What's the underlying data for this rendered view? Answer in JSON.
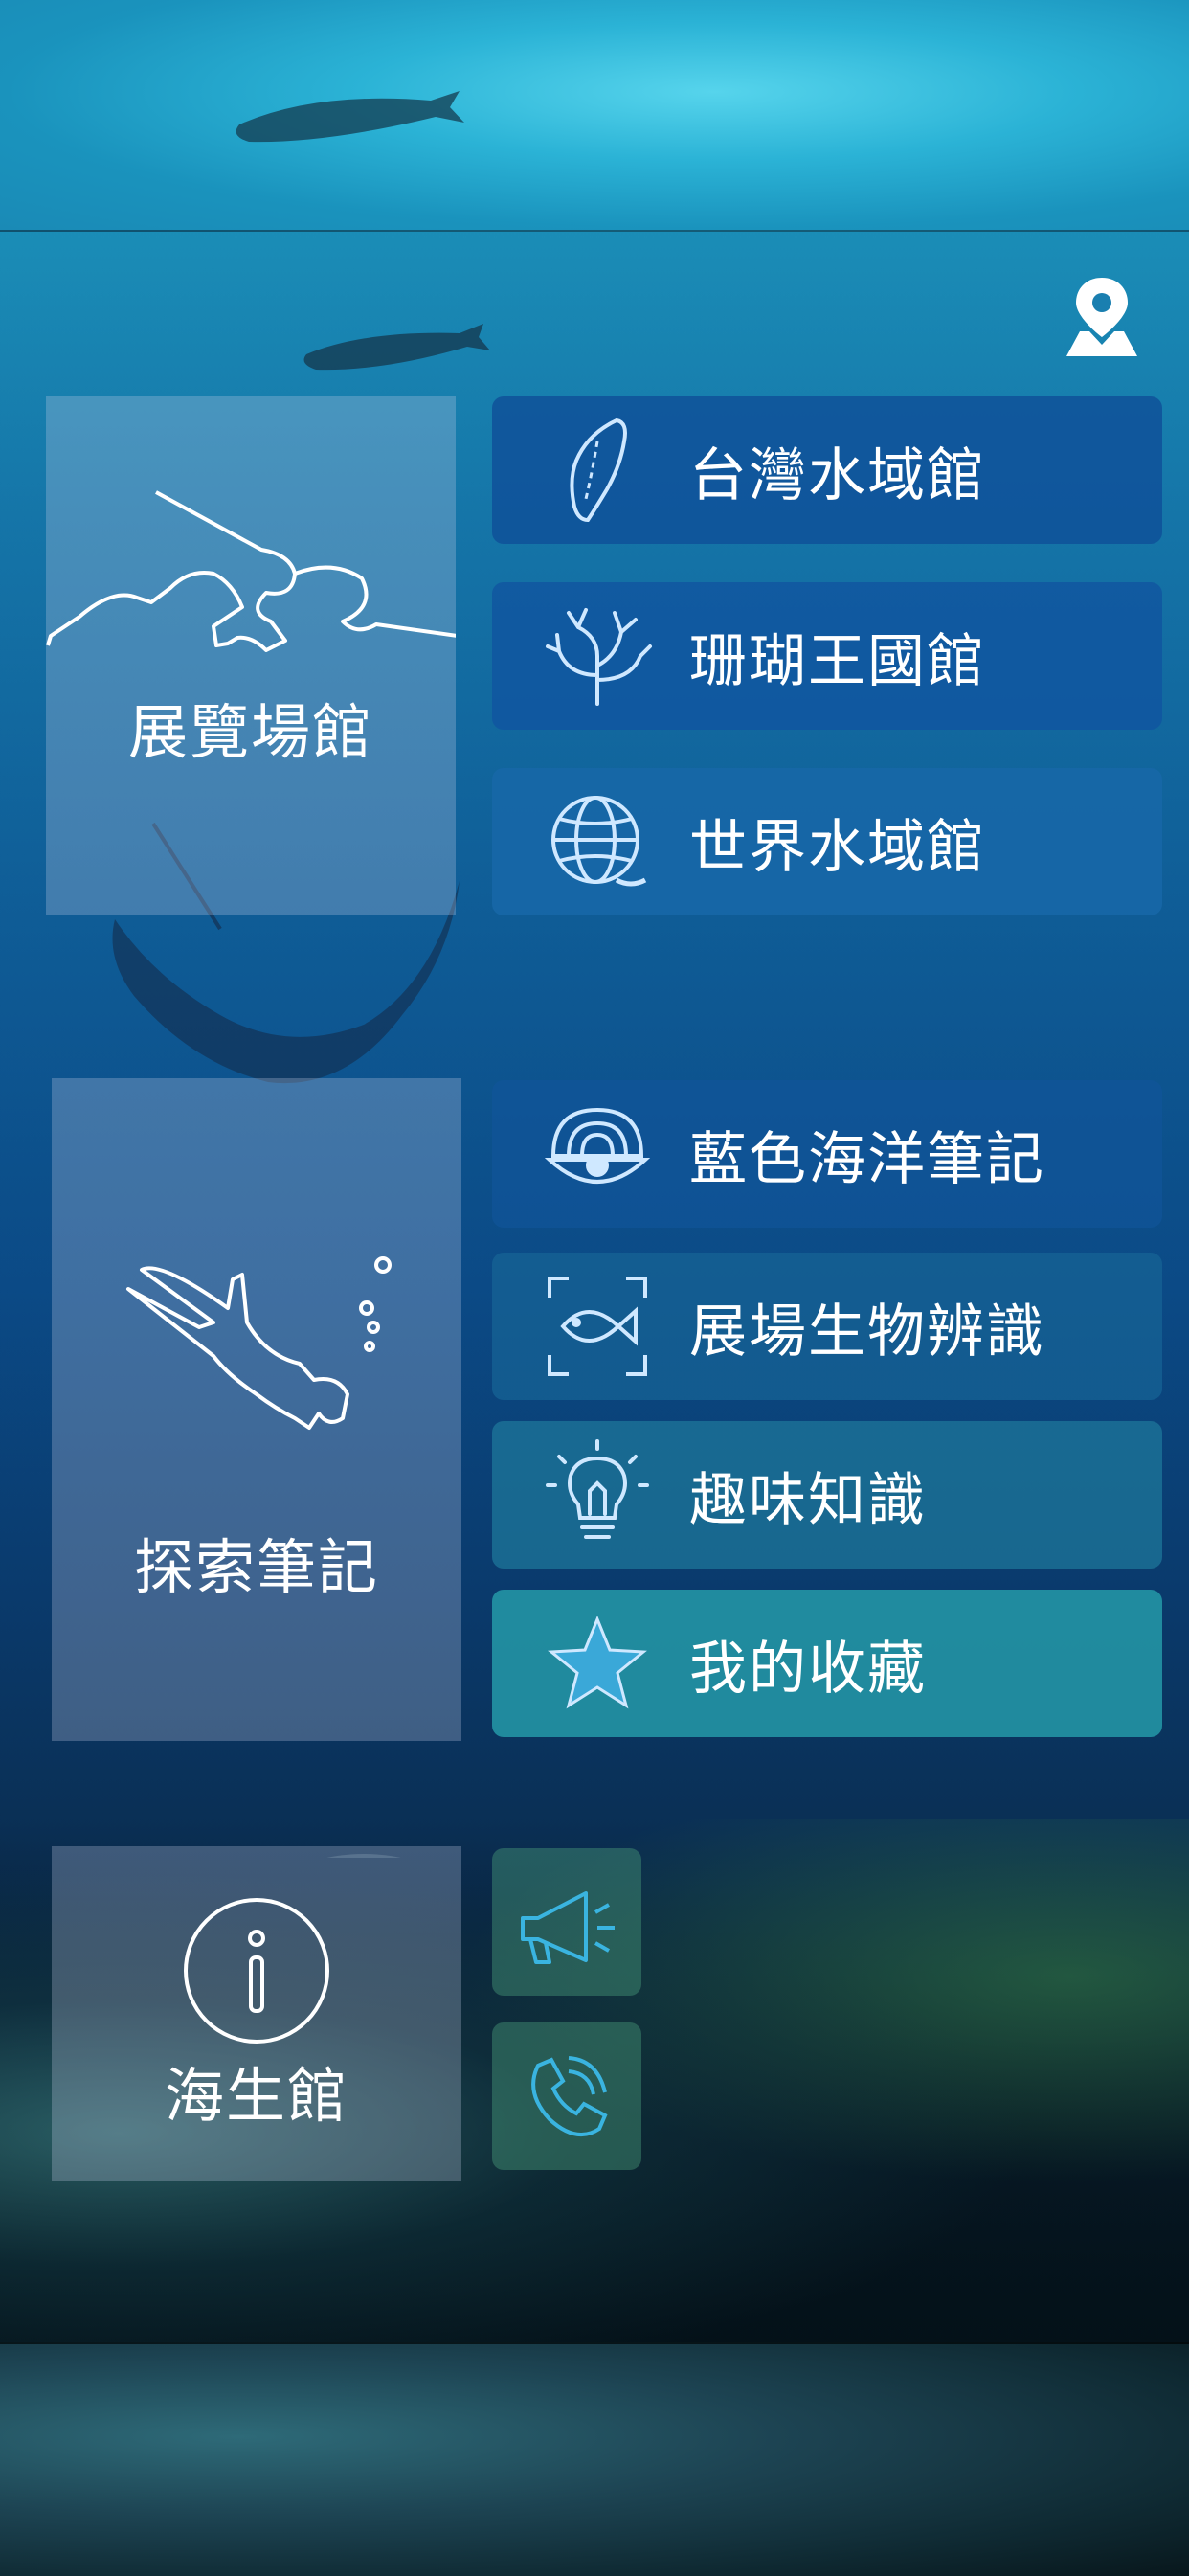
{
  "colors": {
    "button_dark": "#0f4f99",
    "button_mid": "#1767a8",
    "button_teal": "#2396a6",
    "panel": "rgba(200,210,235,0.28)"
  },
  "header": {
    "map_icon": "map-pin-icon"
  },
  "sections": {
    "exhibit": {
      "label": "展覽場館",
      "icon": "narwhal-outline-icon",
      "items": [
        {
          "label": "台灣水域館",
          "icon": "taiwan-icon"
        },
        {
          "label": "珊瑚王國館",
          "icon": "coral-icon"
        },
        {
          "label": "世界水域館",
          "icon": "globe-icon"
        }
      ]
    },
    "explore": {
      "label": "探索筆記",
      "icon": "diver-icon",
      "items": [
        {
          "label": "藍色海洋筆記",
          "icon": "shell-pearl-icon"
        },
        {
          "label": "展場生物辨識",
          "icon": "fish-scan-icon"
        },
        {
          "label": "趣味知識",
          "icon": "lightbulb-icon"
        },
        {
          "label": "我的收藏",
          "icon": "star-icon"
        }
      ]
    },
    "info": {
      "label": "海生館",
      "icon": "info-icon",
      "items": [
        {
          "icon": "megaphone-icon"
        },
        {
          "icon": "phone-icon"
        }
      ]
    }
  }
}
